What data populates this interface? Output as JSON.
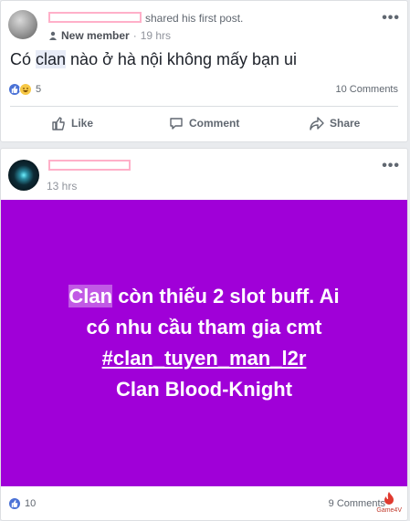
{
  "post1": {
    "header_action": "shared his first post.",
    "badge_label": "New member",
    "separator": "·",
    "time": "19 hrs",
    "more": "•••",
    "text_before": "Có ",
    "text_highlight": "clan",
    "text_after": " nào ở hà nội không mấy bạn ui",
    "reaction_count": "5",
    "comments_count": "10 Comments",
    "actions": {
      "like": "Like",
      "comment": "Comment",
      "share": "Share"
    }
  },
  "post2": {
    "time": "13 hrs",
    "more": "•••",
    "image_lines": [
      {
        "highlight": "Clan",
        "rest": " còn thiếu 2 slot buff. Ai"
      },
      {
        "text": "có nhu cầu tham gia cmt"
      },
      {
        "hashtag": "#clan_tuyen_man_l2r"
      },
      {
        "highlight": "Clan",
        "rest": " Blood-Knight"
      }
    ],
    "reaction_count": "10",
    "comments_count": "9 Comments"
  },
  "watermark": "Game4V",
  "colors": {
    "accent": "#4b72d6",
    "image_bg": "#a000d8",
    "redaction": "#ffb0c9"
  }
}
